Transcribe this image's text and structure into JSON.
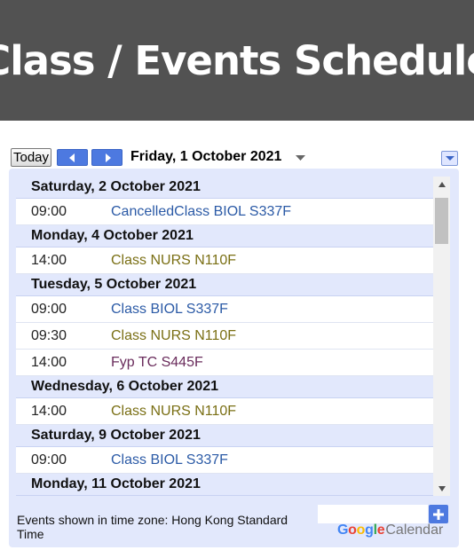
{
  "page": {
    "title": "Class / Events Schedule"
  },
  "toolbar": {
    "today_label": "Today",
    "current_date": "Friday, 1 October 2021"
  },
  "colors": {
    "banner_bg": "#525252",
    "panel_bg": "#e2e8fc",
    "nav_blue": "#4d79e0",
    "event_blue": "#2b5aa6",
    "event_olive": "#7a6f14",
    "event_purple": "#6a2c5c"
  },
  "icons": {
    "prev": "arrow-left-icon",
    "next": "arrow-right-icon",
    "date_dropdown": "chevron-down-icon",
    "menu": "dropdown-menu-icon",
    "add": "plus-icon"
  },
  "agenda": {
    "days": [
      {
        "date": "Saturday, 2 October 2021",
        "events": [
          {
            "time": "09:00",
            "title": "CancelledClass BIOL S337F",
            "color": "#2b5aa6"
          }
        ]
      },
      {
        "date": "Monday, 4 October 2021",
        "events": [
          {
            "time": "14:00",
            "title": "Class NURS N110F",
            "color": "#7a6f14"
          }
        ]
      },
      {
        "date": "Tuesday, 5 October 2021",
        "events": [
          {
            "time": "09:00",
            "title": "Class BIOL S337F",
            "color": "#2b5aa6"
          },
          {
            "time": "09:30",
            "title": "Class NURS N110F",
            "color": "#7a6f14"
          },
          {
            "time": "14:00",
            "title": "Fyp TC S445F",
            "color": "#6a2c5c"
          }
        ]
      },
      {
        "date": "Wednesday, 6 October 2021",
        "events": [
          {
            "time": "14:00",
            "title": "Class NURS N110F",
            "color": "#7a6f14"
          }
        ]
      },
      {
        "date": "Saturday, 9 October 2021",
        "events": [
          {
            "time": "09:00",
            "title": "Class BIOL S337F",
            "color": "#2b5aa6"
          }
        ]
      },
      {
        "date": "Monday, 11 October 2021",
        "events": []
      }
    ]
  },
  "footer": {
    "timezone_note": "Events shown in time zone: Hong Kong Standard Time",
    "brand_google": "Google",
    "brand_calendar": "Calendar"
  }
}
